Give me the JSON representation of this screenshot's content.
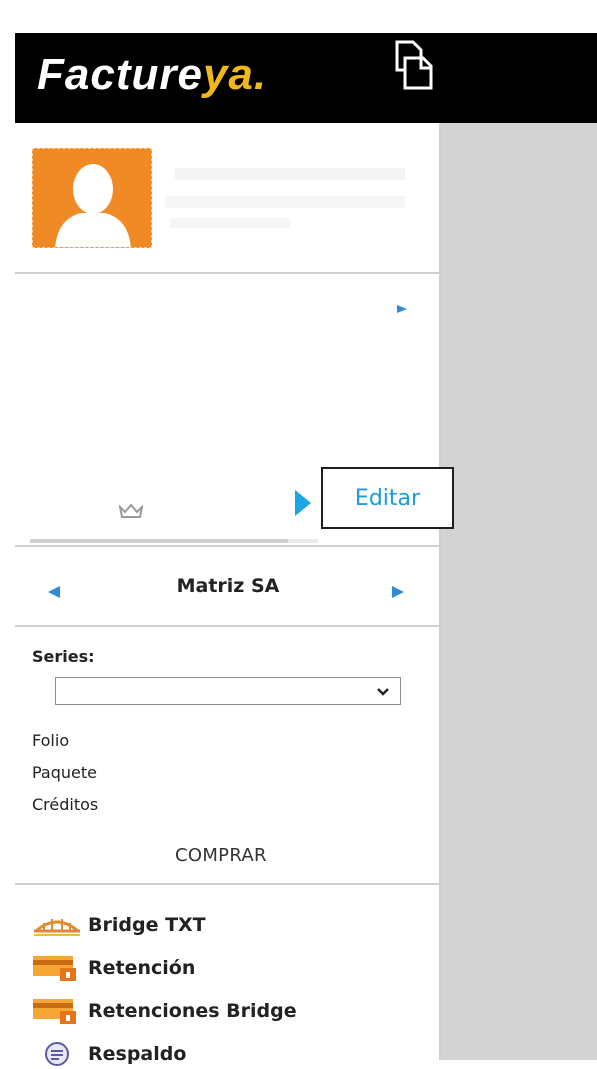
{
  "header": {
    "logo_main": "Facture",
    "logo_accent": "ya",
    "logo_dot": "."
  },
  "profile_panel": {
    "editar_label": "Editar"
  },
  "company_switcher": {
    "name": "Matriz SA"
  },
  "series_panel": {
    "series_label": "Series:",
    "series_value": "",
    "folio_label": "Folio",
    "paquete_label": "Paquete",
    "creditos_label": "Créditos",
    "comprar_label": "COMPRAR"
  },
  "menu": {
    "items": [
      {
        "label": "Bridge TXT",
        "icon": "bridge-icon"
      },
      {
        "label": "Retención",
        "icon": "retention-card-icon"
      },
      {
        "label": "Retenciones Bridge",
        "icon": "retention-card-icon"
      },
      {
        "label": "Respaldo",
        "icon": "backup-icon"
      }
    ]
  },
  "colors": {
    "topbar": "#000000",
    "logo_accent": "#f0b81b",
    "avatar": "#f08a24",
    "arrow_blue": "#2e8bd8",
    "editar_text": "#1a9ce0",
    "main_area": "#d3d3d3"
  }
}
